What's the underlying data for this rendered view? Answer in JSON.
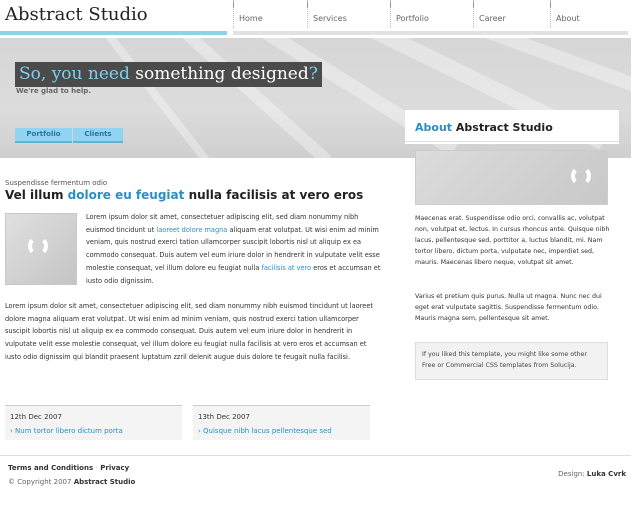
{
  "header": {
    "logo": "Abstract Studio",
    "nav": [
      "Home",
      "Services",
      "Portfolio",
      "Career",
      "About"
    ]
  },
  "hero": {
    "title_part1": "So, you need",
    "title_part2": "something designed",
    "title_part3": "?",
    "subtitle": "We're glad to help.",
    "tabs": [
      "Portfolio",
      "Clients"
    ]
  },
  "main": {
    "kicker": "Suspendisse fermentum odio",
    "title_part1": "Vel illum",
    "title_accent": "dolore eu feugiat",
    "title_part2": "nulla facilisis at vero eros",
    "para1_text": "Lorem ipsum dolor sit amet, consectetuer adipiscing elit, sed diam nonummy nibh euismod tincidunt ut",
    "para1_link1": "laoreet dolore magna",
    "para1_text2": "aliquam erat volutpat. Ut wisi enim ad minim veniam, quis nostrud exerci tation ullamcorper suscipit lobortis nisl ut aliquip ex ea commodo consequat. Duis autem vel eum iriure dolor in hendrerit in vulputate velit esse molestie consequat, vel illum dolore eu feugiat nulla",
    "para1_link2": "facilisis at vero",
    "para1_text3": "eros et accumsan et iusto odio dignissim.",
    "para2": "Lorem ipsum dolor sit amet, consectetuer adipiscing elit, sed diam nonummy nibh euismod tincidunt ut laoreet dolore magna aliquam erat volutpat. Ut wisi enim ad minim veniam, quis nostrud exerci tation ullamcorper suscipit lobortis nisl ut aliquip ex ea commodo consequat. Duis autem vel eum iriure dolor in hendrerit in vulputate velit esse molestie consequat, vel illum dolore eu feugiat nulla facilisis at vero eros et accumsan et iusto odio dignissim qui blandit praesent luptatum zzril delenit augue duis dolore te feugait nulla facilisi.",
    "news": [
      {
        "date": "12th Dec 2007",
        "link": "› Num tortor libero dictum porta"
      },
      {
        "date": "13th Dec 2007",
        "link": "› Quisque nibh lacus pellentesque sed"
      }
    ]
  },
  "sidebar": {
    "title_accent": "About",
    "title_rest": "Abstract Studio",
    "para1": "Maecenas erat. Suspendisse odio orci, convallis ac, volutpat non, volutpat et, lectus. In cursus rhoncus ante. Quisque nibh lacus, pellentesque sed, porttitor a, luctus blandit, mi. Nam tortor libero, dictum porta, vulputate nec, imperdiet sed, mauris. Maecenas libero neque, volutpat sit amet.",
    "para2": "Varius et pretium quis purus. Nulla ut magna. Nunc nec dui eget erat vulputate sagittis. Suspendisse fermentum odio. Mauris magna sem, pellentesque sit amet.",
    "promo": "If you liked this template, you might like some other Free or Commercial CSS templates from Solucija."
  },
  "footer": {
    "link1": "Terms and Conditions",
    "sep": "·",
    "link2": "Privacy",
    "copy": "© Copyright 2007",
    "copy_brand": "Abstract Studio",
    "design_label": "Design:",
    "design_name": "Luka Cvrk"
  },
  "colors": {
    "accent": "#2a8fc4",
    "light_accent": "#8fd0ea"
  }
}
